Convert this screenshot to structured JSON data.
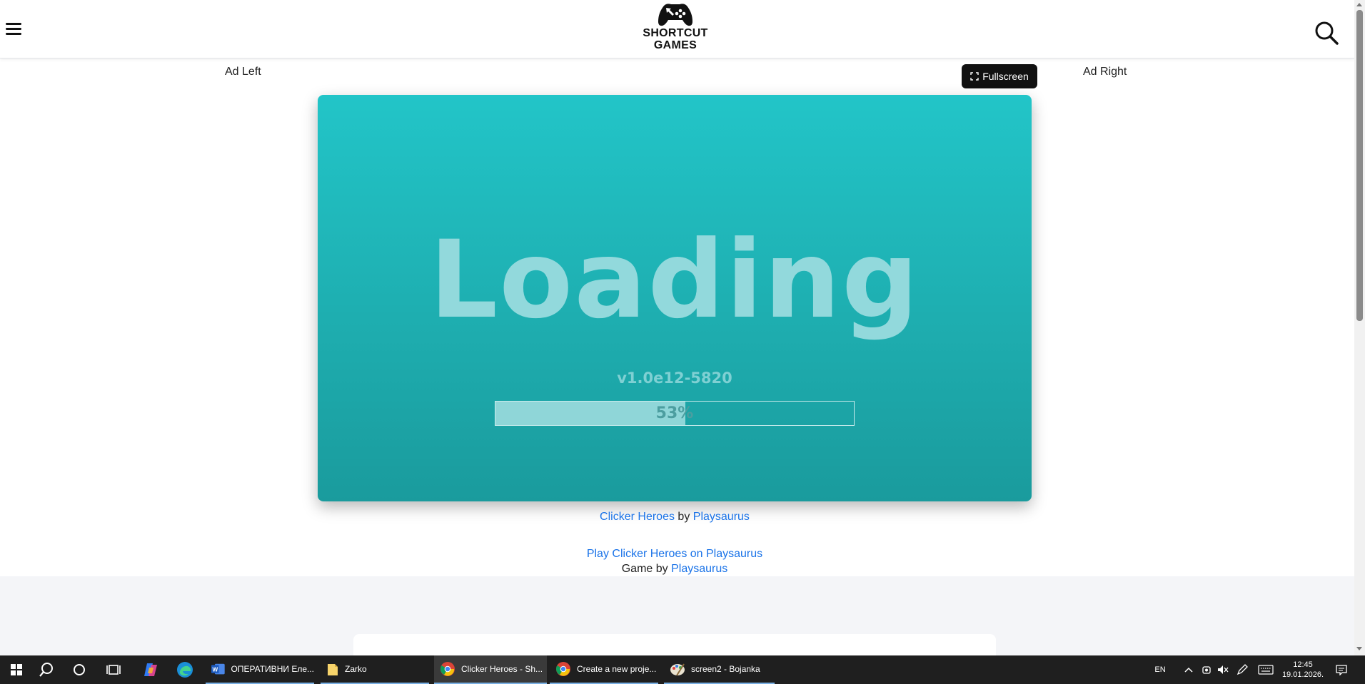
{
  "header": {
    "logo_line1": "SHORTCUT",
    "logo_line2": "GAMES",
    "menu_icon": "hamburger-menu-icon",
    "search_icon": "search-icon"
  },
  "ads": {
    "left": "Ad Left",
    "right": "Ad Right"
  },
  "fullscreen": {
    "label": "Fullscreen",
    "icon": "expand-icon"
  },
  "game": {
    "loading_text": "Loading",
    "version": "v1.0e12-5820",
    "progress_label": "53%",
    "progress_fraction": 0.53
  },
  "credits": {
    "game_title": "Clicker Heroes",
    "by": "by",
    "developer": "Playsaurus",
    "play_link": "Play Clicker Heroes on Playsaurus",
    "game_by": "Game by",
    "game_by_developer": "Playsaurus"
  },
  "taskbar": {
    "apps": [
      {
        "label": "ОПЕРАТИВНИ Еле...",
        "icon": "word-icon"
      },
      {
        "label": "Zarko",
        "icon": "folder-icon"
      },
      {
        "label": "Clicker Heroes - Sh...",
        "icon": "chrome-icon"
      },
      {
        "label": "Create a new proje...",
        "icon": "chrome-icon"
      },
      {
        "label": "screen2 - Bojanka",
        "icon": "paint-icon"
      }
    ],
    "language": "EN",
    "time": "12:45",
    "date": "19.01.2026."
  },
  "colors": {
    "game_bg_top": "#22c5c8",
    "game_bg_bottom": "#1a9b9d",
    "link": "#1a73e8",
    "taskbar": "#1f1f1f"
  }
}
